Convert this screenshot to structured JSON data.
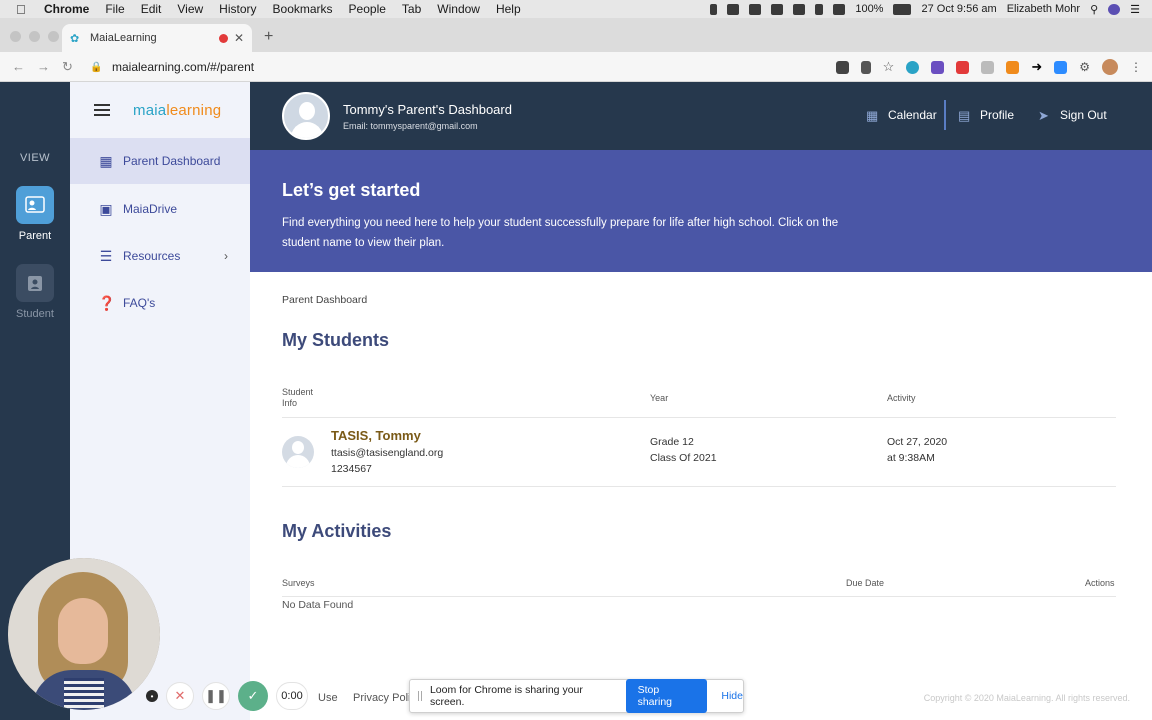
{
  "os_menubar": {
    "app_name": "Chrome",
    "menus": [
      "File",
      "Edit",
      "View",
      "History",
      "Bookmarks",
      "People",
      "Tab",
      "Window",
      "Help"
    ],
    "battery": "100%",
    "datetime": "27 Oct  9:56 am",
    "user": "Elizabeth Mohr"
  },
  "browser": {
    "tab_title": "MaiaLearning",
    "url": "maialearning.com/#/parent"
  },
  "left_rail": {
    "view_label": "VIEW",
    "parent_label": "Parent",
    "student_label": "Student"
  },
  "sidebar": {
    "brand_prefix": "maia",
    "brand_suffix": "learning",
    "items": [
      {
        "label": "Parent Dashboard",
        "icon": "grid-icon"
      },
      {
        "label": "MaiaDrive",
        "icon": "inbox-icon"
      },
      {
        "label": "Resources",
        "icon": "list-icon"
      },
      {
        "label": "FAQ's",
        "icon": "question-icon"
      }
    ]
  },
  "header": {
    "dashboard_title": "Tommy's Parent's Dashboard",
    "email": "Email: tommysparent@gmail.com",
    "calendar": "Calendar",
    "profile": "Profile",
    "sign_out": "Sign Out"
  },
  "hero": {
    "title": "Let’s get started",
    "description": "Find everything you need here to help your student successfully prepare for life after high school. Click on the student name to view their plan."
  },
  "main": {
    "breadcrumb": "Parent Dashboard",
    "students_title": "My Students",
    "students_columns": {
      "info_line1": "Student",
      "info_line2": "Info",
      "year": "Year",
      "activity": "Activity"
    },
    "student": {
      "name": "TASIS, Tommy",
      "email": "ttasis@tasisengland.org",
      "id": "1234567",
      "grade": "Grade 12",
      "class_of": "Class Of 2021",
      "activity_date": "Oct 27, 2020",
      "activity_time": "at 9:38AM"
    },
    "activities_title": "My Activities",
    "activities_columns": {
      "surveys": "Surveys",
      "due_date": "Due Date",
      "actions": "Actions"
    },
    "empty_text": "No Data Found",
    "footer_copyright": "Copyright © 2020 MaiaLearning. All rights reserved.",
    "footer_use": "Use",
    "footer_privacy": "Privacy Poli"
  },
  "loom": {
    "banner_text": "Loom for Chrome is sharing your screen.",
    "stop_sharing": "Stop sharing",
    "hide": "Hide",
    "timer": "0:00"
  }
}
